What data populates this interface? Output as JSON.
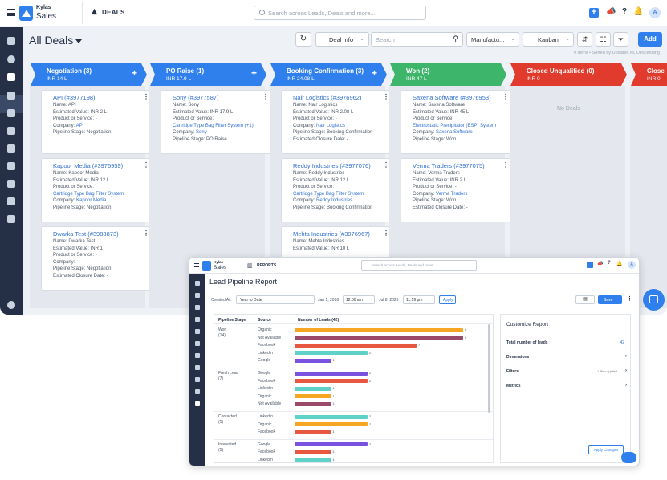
{
  "brand": {
    "name_top": "Kylas",
    "name_bottom": "Sales"
  },
  "header": {
    "module": "DEALS",
    "search_placeholder": "Search across Leads, Deals and more...",
    "avatar": "A"
  },
  "toolbar": {
    "title": "All Deals",
    "view_select": "Deal Info",
    "search_placeholder": "Search",
    "filter_select": "Manufactu...",
    "layout_select": "Kanban",
    "add_label": "Add",
    "meta": "9 items • Sorted by Updated At, Descending"
  },
  "columns": [
    {
      "title": "Negotiation (3)",
      "value": "INR 14 L",
      "color": "#2f80ed",
      "plus": "+",
      "cards": [
        {
          "title": "API (#3977198)",
          "lines": [
            [
              "Name:",
              "API",
              ""
            ],
            [
              "Estimated Value:",
              "INR 2 L",
              ""
            ],
            [
              "Product or Service:",
              "-",
              ""
            ],
            [
              "Company:",
              "API",
              "link"
            ],
            [
              "Pipeline Stage:",
              "Negotiation",
              ""
            ]
          ]
        },
        {
          "title": "Kapoor Media (#3976959)",
          "lines": [
            [
              "Name:",
              "Kapoor Media",
              ""
            ],
            [
              "Estimated Value:",
              "INR 12 L",
              ""
            ],
            [
              "Product or Service:",
              "",
              ""
            ],
            [
              "",
              "Cartridge Type Bag Filter System",
              "link"
            ],
            [
              "Company:",
              "Kapoor Media",
              "link"
            ],
            [
              "Pipeline Stage:",
              "Negotiation",
              ""
            ]
          ]
        },
        {
          "title": "Dwarka Test (#3983873)",
          "lines": [
            [
              "Name:",
              "Dwarka Test",
              ""
            ],
            [
              "Estimated Value:",
              "INR 1",
              ""
            ],
            [
              "Product or Service:",
              "-",
              ""
            ],
            [
              "Company:",
              "-",
              ""
            ],
            [
              "Pipeline Stage:",
              "Negotiation",
              ""
            ],
            [
              "Estimated Closure Date:",
              "-",
              ""
            ]
          ]
        }
      ]
    },
    {
      "title": "PO Raise (1)",
      "value": "INR 17.9 L",
      "color": "#2f80ed",
      "plus": "+",
      "cards": [
        {
          "title": "Sony (#3977587)",
          "lines": [
            [
              "Name:",
              "Sony",
              ""
            ],
            [
              "Estimated Value:",
              "INR 17.9 L",
              ""
            ],
            [
              "Product or Service:",
              "",
              ""
            ],
            [
              "",
              "Cartridge Type Bag Filter System (+1)",
              "link"
            ],
            [
              "Company:",
              "Sony",
              "link"
            ],
            [
              "Pipeline Stage:",
              "PO Raise",
              ""
            ]
          ]
        }
      ]
    },
    {
      "title": "Booking Confirmation (3)",
      "value": "INR 24.08 L",
      "color": "#2f80ed",
      "plus": "+",
      "cards": [
        {
          "title": "Nair Logistics (#3976962)",
          "lines": [
            [
              "Name:",
              "Nair Logistics",
              ""
            ],
            [
              "Estimated Value:",
              "INR 2.08 L",
              ""
            ],
            [
              "Product or Service:",
              "-",
              ""
            ],
            [
              "Company:",
              "Nair Logistics",
              "link"
            ],
            [
              "Pipeline Stage:",
              "Booking Confirmation",
              ""
            ],
            [
              "Estimated Closure Date:",
              "-",
              ""
            ]
          ]
        },
        {
          "title": "Reddy Industries (#3977076)",
          "lines": [
            [
              "Name:",
              "Reddy Industries",
              ""
            ],
            [
              "Estimated Value:",
              "INR 12 L",
              ""
            ],
            [
              "Product or Service:",
              "",
              ""
            ],
            [
              "",
              "Cartridge Type Bag Filter System",
              "link"
            ],
            [
              "Company:",
              "Reddy Industries",
              "link"
            ],
            [
              "Pipeline Stage:",
              "Booking Confirmation",
              ""
            ]
          ]
        },
        {
          "title": "Mehta Industries (#3976967)",
          "lines": [
            [
              "Name:",
              "Mehta Industries",
              ""
            ],
            [
              "Estimated Value:",
              "INR 10 L",
              ""
            ]
          ]
        }
      ]
    },
    {
      "title": "Won (2)",
      "value": "INR 47 L",
      "color": "#3db56a",
      "plus": "",
      "cards": [
        {
          "title": "Saxena Software (#3976953)",
          "lines": [
            [
              "Name:",
              "Saxena Software",
              ""
            ],
            [
              "Estimated Value:",
              "INR 45 L",
              ""
            ],
            [
              "Product or Service:",
              "",
              ""
            ],
            [
              "",
              "Electrostatic Precipitator (ESP) System",
              "link"
            ],
            [
              "Company:",
              "Saxena Software",
              "link"
            ],
            [
              "Pipeline Stage:",
              "Won",
              ""
            ]
          ]
        },
        {
          "title": "Verma Traders (#3977075)",
          "lines": [
            [
              "Name:",
              "Verma Traders",
              ""
            ],
            [
              "Estimated Value:",
              "INR 2 L",
              ""
            ],
            [
              "Product or Service:",
              "-",
              ""
            ],
            [
              "Company:",
              "Verma Traders",
              "link"
            ],
            [
              "Pipeline Stage:",
              "Won",
              ""
            ],
            [
              "Estimated Closure Date:",
              "-",
              ""
            ]
          ]
        }
      ]
    },
    {
      "title": "Closed Unqualified (0)",
      "value": "INR 0",
      "color": "#e03b2c",
      "plus": "",
      "empty": "No Deals",
      "cards": []
    },
    {
      "title": "Close",
      "value": "INR 0",
      "color": "#e03b2c",
      "plus": "",
      "cards": []
    }
  ],
  "report": {
    "module": "REPORTS",
    "brand_top": "Kylas",
    "brand_bottom": "Sales",
    "search_placeholder": "Search across Leads, Deals and more...",
    "avatar": "A",
    "title": "Lead Pipeline Report",
    "created_at_label": "Created At:",
    "range": "Year to Date",
    "date_from": "Jan 1, 2026",
    "time_from": "12:00 am",
    "date_to": "Jul 8, 2026",
    "time_to": "11:59 pm",
    "apply": "Apply",
    "save": "Save",
    "headers": [
      "Pipeline Stage",
      "Source",
      "Number of Leads (42)"
    ],
    "customize": {
      "title": "Customize Report",
      "total_label": "Total number of leads",
      "total_value": "42",
      "dimensions": "Dimensions",
      "filters": "Filters",
      "filter_note": "1 filter applied",
      "metrics": "Metrics",
      "apply_changes": "Apply Changes"
    }
  },
  "chart_data": {
    "type": "bar",
    "title": "Lead Pipeline Report",
    "xlabel": "",
    "ylabel": "Number of Leads (42)",
    "groups": [
      {
        "stage": "Won",
        "count": "(14)",
        "rows": [
          [
            "Organic",
            6,
            "#f5a623"
          ],
          [
            "Not Available",
            6,
            "#9b4a6a"
          ],
          [
            "Facebook",
            7,
            "#e8573f"
          ],
          [
            "LinkedIn",
            2,
            "#5ed1c8"
          ],
          [
            "Google",
            1,
            "#7a52e0"
          ]
        ]
      },
      {
        "stage": "Fresh Lead",
        "count": "(7)",
        "rows": [
          [
            "Google",
            2,
            "#7a52e0"
          ],
          [
            "Facebook",
            2,
            "#e8573f"
          ],
          [
            "LinkedIn",
            1,
            "#5ed1c8"
          ],
          [
            "Organic",
            1,
            "#f5a623"
          ],
          [
            "Not Available",
            1,
            "#9b4a6a"
          ]
        ]
      },
      {
        "stage": "Contacted",
        "count": "(5)",
        "rows": [
          [
            "LinkedIn",
            2,
            "#5ed1c8"
          ],
          [
            "Organic",
            2,
            "#f5a623"
          ],
          [
            "Facebook",
            1,
            "#e8573f"
          ]
        ]
      },
      {
        "stage": "Interested",
        "count": "(5)",
        "rows": [
          [
            "Google",
            2,
            "#7a52e0"
          ],
          [
            "Facebook",
            1,
            "#e8573f"
          ],
          [
            "LinkedIn",
            1,
            "#5ed1c8"
          ]
        ]
      }
    ],
    "xlim": [
      0,
      7
    ]
  }
}
